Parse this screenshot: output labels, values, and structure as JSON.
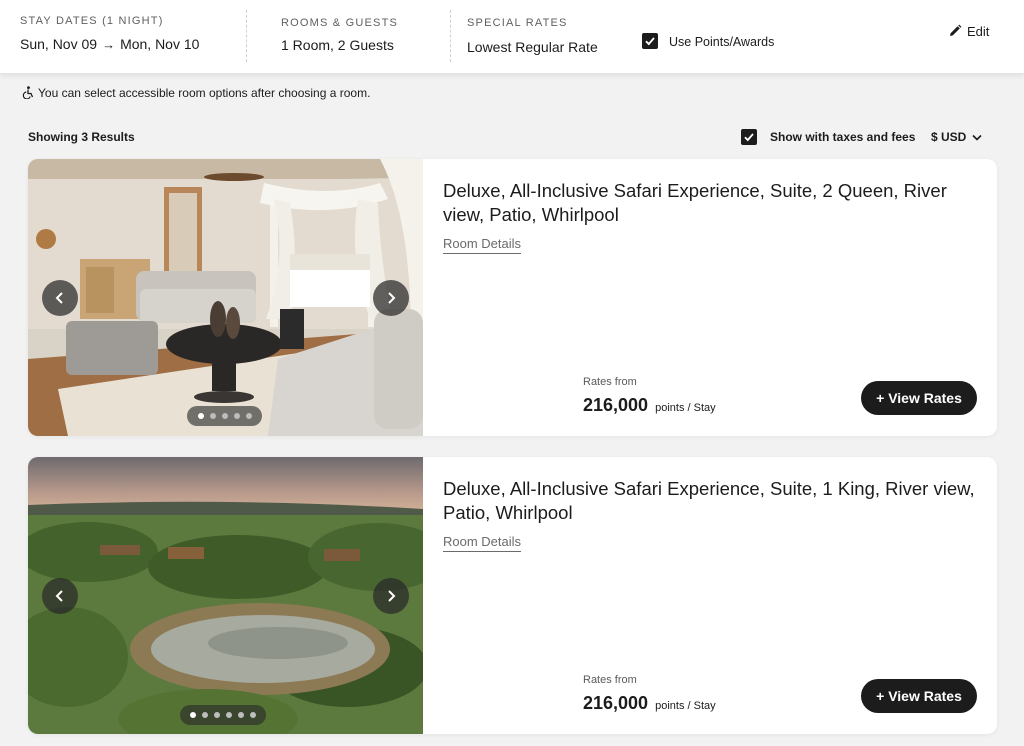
{
  "header": {
    "stay_dates_label": "STAY DATES (1 NIGHT)",
    "check_in": "Sun, Nov 09",
    "check_out": "Mon, Nov 10",
    "rooms_guests_label": "ROOMS & GUESTS",
    "rooms_guests_value": "1 Room, 2 Guests",
    "special_rates_label": "SPECIAL RATES",
    "special_rates_value": "Lowest Regular Rate",
    "use_points_label": "Use Points/Awards",
    "use_points_checked": true,
    "edit_label": "Edit"
  },
  "accessibility_note": "You can select accessible room options after choosing a room.",
  "results": {
    "count_label": "Showing 3 Results",
    "taxes_label": "Show with taxes and fees",
    "taxes_checked": true,
    "currency": "$ USD"
  },
  "rooms": [
    {
      "title": "Deluxe, All-Inclusive Safari Experience, Suite, 2 Queen, River view, Patio, Whirlpool",
      "details_link": "Room Details",
      "rates_from_label": "Rates from",
      "points": "216,000",
      "points_unit": "points / Stay",
      "cta": "+ View Rates",
      "image_count": 5,
      "active_image": 1
    },
    {
      "title": "Deluxe, All-Inclusive Safari Experience, Suite, 1 King, River view, Patio, Whirlpool",
      "details_link": "Room Details",
      "rates_from_label": "Rates from",
      "points": "216,000",
      "points_unit": "points / Stay",
      "cta": "+ View Rates",
      "image_count": 6,
      "active_image": 1
    }
  ],
  "colors": {
    "background": "#f2f2f2",
    "card": "#ffffff",
    "primary_button": "#1c1c1c",
    "text": "#1c1c1c",
    "muted_text": "#6b6b6b"
  }
}
